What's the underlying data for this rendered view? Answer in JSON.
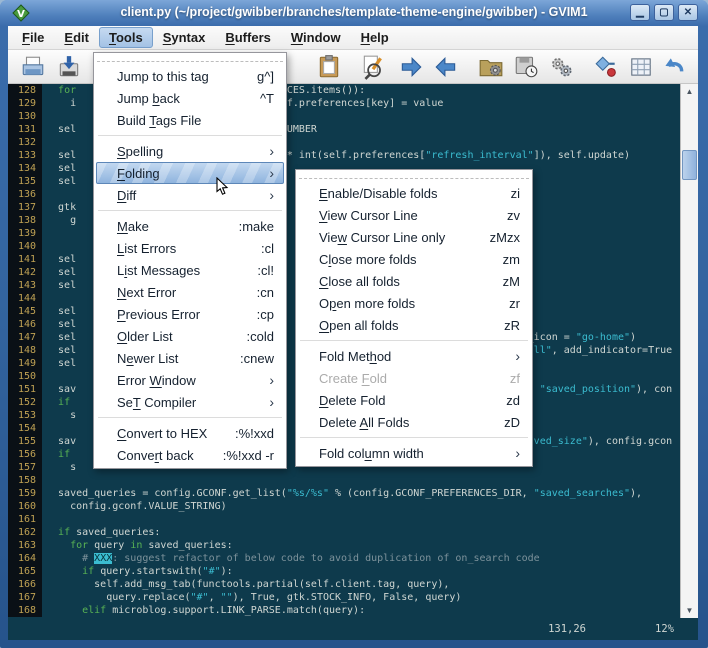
{
  "window": {
    "title": "client.py (~/project/gwibber/branches/template-theme-engine/gwibber) - GVIM1",
    "controls": [
      "minimize",
      "maximize",
      "close"
    ]
  },
  "colors": {
    "titlebar": "#4f80bc",
    "editor_bg": "#0e3a4c",
    "gutter_bg": "#0a1016",
    "line_number": "#c0a254",
    "text": "#cfd6d2",
    "keyword": "#58b254",
    "string": "#3bbcd0",
    "comment": "#7d929b",
    "menu_highlight": "#8fb4de"
  },
  "menubar": {
    "items": [
      {
        "pre": "",
        "ul": "F",
        "post": "ile",
        "active": false
      },
      {
        "pre": "",
        "ul": "E",
        "post": "dit",
        "active": false
      },
      {
        "pre": "",
        "ul": "T",
        "post": "ools",
        "active": true
      },
      {
        "pre": "",
        "ul": "S",
        "post": "yntax",
        "active": false
      },
      {
        "pre": "",
        "ul": "B",
        "post": "uffers",
        "active": false
      },
      {
        "pre": "",
        "ul": "W",
        "post": "indow",
        "active": false
      },
      {
        "pre": "",
        "ul": "H",
        "post": "elp",
        "active": false
      }
    ]
  },
  "toolbar": {
    "icons": [
      "open-file",
      "save-file",
      "paste",
      "find-replace",
      "find-next",
      "find-prev",
      "session-load",
      "session-save",
      "run-script",
      "make",
      "build-tags",
      "tag-jump"
    ]
  },
  "tools_menu": {
    "items": [
      {
        "t": "item",
        "pre": "Jump to this tag",
        "ul": "",
        "post": "",
        "sc": "g^]"
      },
      {
        "t": "item",
        "pre": "Jump ",
        "ul": "b",
        "post": "ack",
        "sc": "^T"
      },
      {
        "t": "item",
        "pre": "Build ",
        "ul": "T",
        "post": "ags File",
        "sc": ""
      },
      {
        "t": "sep"
      },
      {
        "t": "item",
        "pre": "",
        "ul": "S",
        "post": "pelling",
        "arrow": true
      },
      {
        "t": "item",
        "pre": "",
        "ul": "F",
        "post": "olding",
        "arrow": true,
        "hl": true
      },
      {
        "t": "item",
        "pre": "",
        "ul": "D",
        "post": "iff",
        "arrow": true
      },
      {
        "t": "sep"
      },
      {
        "t": "item",
        "pre": "",
        "ul": "M",
        "post": "ake",
        "sc": ":make"
      },
      {
        "t": "item",
        "pre": "",
        "ul": "L",
        "post": "ist Errors",
        "sc": ":cl"
      },
      {
        "t": "item",
        "pre": "L",
        "ul": "i",
        "post": "st Messages",
        "sc": ":cl!"
      },
      {
        "t": "item",
        "pre": "",
        "ul": "N",
        "post": "ext Error",
        "sc": ":cn"
      },
      {
        "t": "item",
        "pre": "",
        "ul": "P",
        "post": "revious Error",
        "sc": ":cp"
      },
      {
        "t": "item",
        "pre": "",
        "ul": "O",
        "post": "lder List",
        "sc": ":cold"
      },
      {
        "t": "item",
        "pre": "N",
        "ul": "e",
        "post": "wer List",
        "sc": ":cnew"
      },
      {
        "t": "item",
        "pre": "Error ",
        "ul": "W",
        "post": "indow",
        "arrow": true
      },
      {
        "t": "item",
        "pre": "Se",
        "ul": "T",
        "post": " Compiler",
        "arrow": true
      },
      {
        "t": "sep"
      },
      {
        "t": "item",
        "pre": "",
        "ul": "C",
        "post": "onvert to HEX",
        "sc": ":%!xxd"
      },
      {
        "t": "item",
        "pre": "Conve",
        "ul": "r",
        "post": "t back",
        "sc": ":%!xxd -r"
      }
    ]
  },
  "folding_submenu": {
    "items": [
      {
        "t": "item",
        "pre": "",
        "ul": "E",
        "post": "nable/Disable folds",
        "sc": "zi"
      },
      {
        "t": "item",
        "pre": "",
        "ul": "V",
        "post": "iew Cursor Line",
        "sc": "zv"
      },
      {
        "t": "item",
        "pre": "Vie",
        "ul": "w",
        "post": " Cursor Line only",
        "sc": "zMzx"
      },
      {
        "t": "item",
        "pre": "C",
        "ul": "l",
        "post": "ose more folds",
        "sc": "zm"
      },
      {
        "t": "item",
        "pre": "",
        "ul": "C",
        "post": "lose all folds",
        "sc": "zM"
      },
      {
        "t": "item",
        "pre": "O",
        "ul": "p",
        "post": "en more folds",
        "sc": "zr"
      },
      {
        "t": "item",
        "pre": "",
        "ul": "O",
        "post": "pen all folds",
        "sc": "zR"
      },
      {
        "t": "sep"
      },
      {
        "t": "item",
        "pre": "Fold Met",
        "ul": "h",
        "post": "od",
        "arrow": true
      },
      {
        "t": "item",
        "pre": "Create ",
        "ul": "F",
        "post": "old",
        "sc": "zf",
        "dis": true
      },
      {
        "t": "item",
        "pre": "",
        "ul": "D",
        "post": "elete Fold",
        "sc": "zd"
      },
      {
        "t": "item",
        "pre": "Delete ",
        "ul": "A",
        "post": "ll Folds",
        "sc": "zD"
      },
      {
        "t": "sep"
      },
      {
        "t": "item",
        "pre": "Fold col",
        "ul": "u",
        "post": "mn width",
        "arrow": true
      }
    ]
  },
  "editor": {
    "lines": [
      {
        "n": 128,
        "seg": [
          [
            "p",
            "  "
          ],
          [
            "k",
            "for"
          ],
          [
            "g",
            34
          ],
          [
            "p",
            "NCES.items()):"
          ]
        ]
      },
      {
        "n": 129,
        "seg": [
          [
            "p",
            "    i"
          ],
          [
            "g",
            34
          ],
          [
            "p",
            "lf.preferences[key] = value"
          ]
        ]
      },
      {
        "n": 130,
        "seg": []
      },
      {
        "n": 131,
        "seg": [
          [
            "p",
            "  sel"
          ],
          [
            "g",
            34
          ],
          [
            "p",
            "NUMBER"
          ]
        ]
      },
      {
        "n": 132,
        "seg": []
      },
      {
        "n": 133,
        "seg": [
          [
            "p",
            "  sel"
          ],
          [
            "g",
            35
          ],
          [
            "p",
            "* int(self.preferences["
          ],
          [
            "s",
            "\"refresh_interval\""
          ],
          [
            "p",
            "]), self.update)"
          ]
        ]
      },
      {
        "n": 134,
        "seg": [
          [
            "p",
            "  sel"
          ]
        ]
      },
      {
        "n": 135,
        "seg": [
          [
            "p",
            "  sel"
          ]
        ]
      },
      {
        "n": 136,
        "seg": []
      },
      {
        "n": 137,
        "seg": [
          [
            "p",
            "  gtk"
          ]
        ]
      },
      {
        "n": 138,
        "seg": [
          [
            "p",
            "    g"
          ]
        ]
      },
      {
        "n": 139,
        "seg": []
      },
      {
        "n": 140,
        "seg": []
      },
      {
        "n": 141,
        "seg": [
          [
            "p",
            "  sel"
          ]
        ]
      },
      {
        "n": 142,
        "seg": [
          [
            "p",
            "  sel"
          ]
        ]
      },
      {
        "n": 143,
        "seg": [
          [
            "p",
            "  sel"
          ]
        ]
      },
      {
        "n": 144,
        "seg": []
      },
      {
        "n": 145,
        "seg": [
          [
            "p",
            "  sel"
          ]
        ]
      },
      {
        "n": 146,
        "seg": [
          [
            "p",
            "  sel"
          ]
        ]
      },
      {
        "n": 147,
        "seg": [
          [
            "p",
            "  sel"
          ],
          [
            "g",
            75
          ],
          [
            "p",
            "_icon = "
          ],
          [
            "s",
            "\"go-home\""
          ],
          [
            "p",
            ")"
          ]
        ]
      },
      {
        "n": 148,
        "seg": [
          [
            "p",
            "  sel"
          ],
          [
            "g",
            75
          ],
          [
            "s",
            "all\""
          ],
          [
            "p",
            ", add_indicator=True"
          ]
        ]
      },
      {
        "n": 149,
        "seg": [
          [
            "p",
            "  sel"
          ]
        ]
      },
      {
        "n": 150,
        "seg": []
      },
      {
        "n": 151,
        "seg": [
          [
            "p",
            "  sav"
          ],
          [
            "g",
            75
          ],
          [
            "p",
            ", "
          ],
          [
            "s",
            "\"saved_position\""
          ],
          [
            "p",
            "), con"
          ]
        ]
      },
      {
        "n": 152,
        "seg": [
          [
            "p",
            "  "
          ],
          [
            "k",
            "if"
          ]
        ]
      },
      {
        "n": 153,
        "seg": [
          [
            "p",
            "    s"
          ]
        ]
      },
      {
        "n": 154,
        "seg": []
      },
      {
        "n": 155,
        "seg": [
          [
            "p",
            "  sav"
          ],
          [
            "g",
            75
          ],
          [
            "s",
            "aved_size\""
          ],
          [
            "p",
            "), config.gcon"
          ]
        ]
      },
      {
        "n": 156,
        "seg": [
          [
            "p",
            "  "
          ],
          [
            "k",
            "if"
          ]
        ]
      },
      {
        "n": 157,
        "seg": [
          [
            "p",
            "    s"
          ]
        ]
      },
      {
        "n": 158,
        "seg": []
      },
      {
        "n": 159,
        "seg": [
          [
            "p",
            "  saved_queries = config.GCONF.get_list("
          ],
          [
            "s",
            "\"%s/%s\""
          ],
          [
            "p",
            " % (config.GCONF_PREFERENCES_DIR, "
          ],
          [
            "s",
            "\"saved_searches\""
          ],
          [
            "p",
            "),"
          ]
        ]
      },
      {
        "n": 160,
        "seg": [
          [
            "p",
            "    config.gconf.VALUE_STRING)"
          ]
        ]
      },
      {
        "n": 161,
        "seg": []
      },
      {
        "n": 162,
        "seg": [
          [
            "p",
            "  "
          ],
          [
            "k",
            "if"
          ],
          [
            "p",
            " saved_queries:"
          ]
        ]
      },
      {
        "n": 163,
        "seg": [
          [
            "p",
            "    "
          ],
          [
            "k",
            "for"
          ],
          [
            "p",
            " query "
          ],
          [
            "k",
            "in"
          ],
          [
            "p",
            " saved_queries:"
          ]
        ]
      },
      {
        "n": 164,
        "seg": [
          [
            "p",
            "      "
          ],
          [
            "c",
            "# "
          ],
          [
            "x",
            "XXX"
          ],
          [
            "c",
            ": suggest refactor of below code to avoid duplication of on_search code"
          ]
        ]
      },
      {
        "n": 165,
        "seg": [
          [
            "p",
            "      "
          ],
          [
            "k",
            "if"
          ],
          [
            "p",
            " query.startswith("
          ],
          [
            "s",
            "\"#\""
          ],
          [
            "p",
            "):"
          ]
        ]
      },
      {
        "n": 166,
        "seg": [
          [
            "p",
            "        self.add_msg_tab(functools.partial(self.client.tag, query),"
          ]
        ]
      },
      {
        "n": 167,
        "seg": [
          [
            "p",
            "          query.replace("
          ],
          [
            "s",
            "\"#\""
          ],
          [
            "p",
            ", "
          ],
          [
            "s",
            "\"\""
          ],
          [
            "p",
            "), True, gtk.STOCK_INFO, False, query)"
          ]
        ]
      },
      {
        "n": 168,
        "seg": [
          [
            "p",
            "      "
          ],
          [
            "k",
            "elif"
          ],
          [
            "p",
            " microblog.support.LINK_PARSE.match(query):"
          ]
        ]
      }
    ]
  },
  "statusbar": {
    "ruler": "131,26",
    "scroll": "12%"
  }
}
